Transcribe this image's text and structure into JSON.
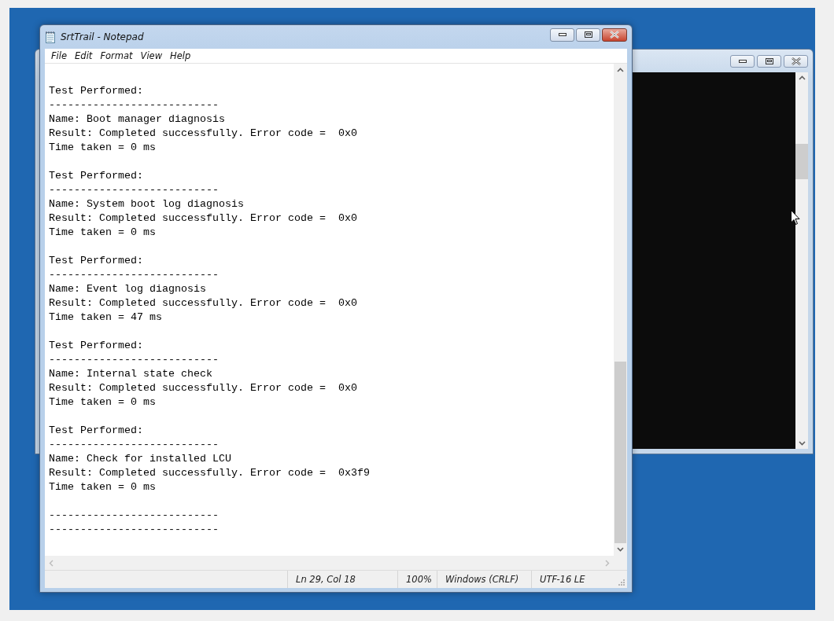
{
  "window": {
    "title": "SrtTrail - Notepad"
  },
  "menu": [
    "File",
    "Edit",
    "Format",
    "View",
    "Help"
  ],
  "document": {
    "blocks": [
      [
        "Test Performed:",
        "---------------------------",
        "Name: Boot manager diagnosis",
        "Result: Completed successfully. Error code =  0x0",
        "Time taken = 0 ms"
      ],
      [
        "Test Performed:",
        "---------------------------",
        "Name: System boot log diagnosis",
        "Result: Completed successfully. Error code =  0x0",
        "Time taken = 0 ms"
      ],
      [
        "Test Performed:",
        "---------------------------",
        "Name: Event log diagnosis",
        "Result: Completed successfully. Error code =  0x0",
        "Time taken = 47 ms"
      ],
      [
        "Test Performed:",
        "---------------------------",
        "Name: Internal state check",
        "Result: Completed successfully. Error code =  0x0",
        "Time taken = 0 ms"
      ],
      [
        "Test Performed:",
        "---------------------------",
        "Name: Check for installed LCU",
        "Result: Completed successfully. Error code =  0x3f9",
        "Time taken = 0 ms"
      ],
      [
        "---------------------------",
        "---------------------------"
      ]
    ]
  },
  "status_bar": [
    "Ln 29, Col 18",
    "100%",
    "Windows (CRLF)",
    "UTF-16 LE"
  ]
}
